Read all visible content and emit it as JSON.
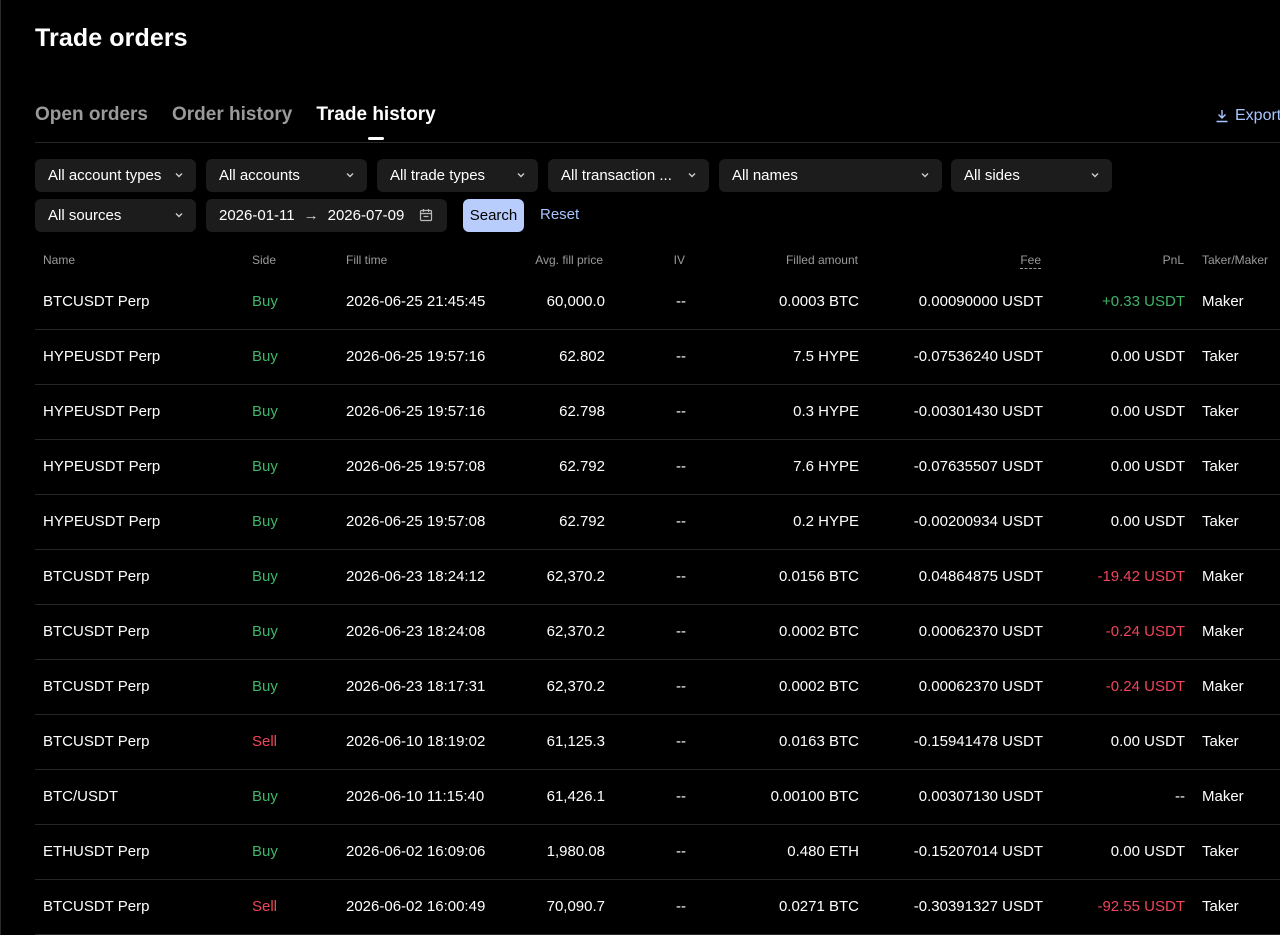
{
  "page": {
    "title": "Trade orders"
  },
  "tabs": [
    {
      "label": "Open orders",
      "active": false
    },
    {
      "label": "Order history",
      "active": false
    },
    {
      "label": "Trade history",
      "active": true
    }
  ],
  "export_label": "Export",
  "filters": {
    "account_types": "All account types",
    "accounts": "All accounts",
    "trade_types": "All trade types",
    "transaction": "All transaction ...",
    "names": "All names",
    "sides": "All sides",
    "sources": "All sources",
    "date_from": "2026-01-11",
    "date_arrow": "→",
    "date_to": "2026-07-09",
    "search_label": "Search",
    "reset_label": "Reset"
  },
  "colors": {
    "buy": "#3fb46a",
    "sell": "#f0455a",
    "accent": "#b9cdfc",
    "link": "#a9c4ff"
  },
  "table": {
    "headers": {
      "name": "Name",
      "side": "Side",
      "fill_time": "Fill time",
      "avg_fill_price": "Avg. fill price",
      "iv": "IV",
      "filled_amount": "Filled amount",
      "fee": "Fee",
      "pnl": "PnL",
      "taker_maker": "Taker/Maker"
    },
    "rows": [
      {
        "name": "BTCUSDT Perp",
        "side": "Buy",
        "time": "2026-06-25 21:45:45",
        "price": "60,000.0",
        "iv": "--",
        "amount": "0.0003 BTC",
        "fee": "0.00090000 USDT",
        "pnl": "+0.33 USDT",
        "pnl_sign": "pos",
        "role": "Maker"
      },
      {
        "name": "HYPEUSDT Perp",
        "side": "Buy",
        "time": "2026-06-25 19:57:16",
        "price": "62.802",
        "iv": "--",
        "amount": "7.5 HYPE",
        "fee": "-0.07536240 USDT",
        "pnl": "0.00 USDT",
        "pnl_sign": "zero",
        "role": "Taker"
      },
      {
        "name": "HYPEUSDT Perp",
        "side": "Buy",
        "time": "2026-06-25 19:57:16",
        "price": "62.798",
        "iv": "--",
        "amount": "0.3 HYPE",
        "fee": "-0.00301430 USDT",
        "pnl": "0.00 USDT",
        "pnl_sign": "zero",
        "role": "Taker"
      },
      {
        "name": "HYPEUSDT Perp",
        "side": "Buy",
        "time": "2026-06-25 19:57:08",
        "price": "62.792",
        "iv": "--",
        "amount": "7.6 HYPE",
        "fee": "-0.07635507 USDT",
        "pnl": "0.00 USDT",
        "pnl_sign": "zero",
        "role": "Taker"
      },
      {
        "name": "HYPEUSDT Perp",
        "side": "Buy",
        "time": "2026-06-25 19:57:08",
        "price": "62.792",
        "iv": "--",
        "amount": "0.2 HYPE",
        "fee": "-0.00200934 USDT",
        "pnl": "0.00 USDT",
        "pnl_sign": "zero",
        "role": "Taker"
      },
      {
        "name": "BTCUSDT Perp",
        "side": "Buy",
        "time": "2026-06-23 18:24:12",
        "price": "62,370.2",
        "iv": "--",
        "amount": "0.0156 BTC",
        "fee": "0.04864875 USDT",
        "pnl": "-19.42 USDT",
        "pnl_sign": "neg",
        "role": "Maker"
      },
      {
        "name": "BTCUSDT Perp",
        "side": "Buy",
        "time": "2026-06-23 18:24:08",
        "price": "62,370.2",
        "iv": "--",
        "amount": "0.0002 BTC",
        "fee": "0.00062370 USDT",
        "pnl": "-0.24 USDT",
        "pnl_sign": "neg",
        "role": "Maker"
      },
      {
        "name": "BTCUSDT Perp",
        "side": "Buy",
        "time": "2026-06-23 18:17:31",
        "price": "62,370.2",
        "iv": "--",
        "amount": "0.0002 BTC",
        "fee": "0.00062370 USDT",
        "pnl": "-0.24 USDT",
        "pnl_sign": "neg",
        "role": "Maker"
      },
      {
        "name": "BTCUSDT Perp",
        "side": "Sell",
        "time": "2026-06-10 18:19:02",
        "price": "61,125.3",
        "iv": "--",
        "amount": "0.0163 BTC",
        "fee": "-0.15941478 USDT",
        "pnl": "0.00 USDT",
        "pnl_sign": "zero",
        "role": "Taker"
      },
      {
        "name": "BTC/USDT",
        "side": "Buy",
        "time": "2026-06-10 11:15:40",
        "price": "61,426.1",
        "iv": "--",
        "amount": "0.00100 BTC",
        "fee": "0.00307130 USDT",
        "pnl": "--",
        "pnl_sign": "zero",
        "role": "Maker"
      },
      {
        "name": "ETHUSDT Perp",
        "side": "Buy",
        "time": "2026-06-02 16:09:06",
        "price": "1,980.08",
        "iv": "--",
        "amount": "0.480 ETH",
        "fee": "-0.15207014 USDT",
        "pnl": "0.00 USDT",
        "pnl_sign": "zero",
        "role": "Taker"
      },
      {
        "name": "BTCUSDT Perp",
        "side": "Sell",
        "time": "2026-06-02 16:00:49",
        "price": "70,090.7",
        "iv": "--",
        "amount": "0.0271 BTC",
        "fee": "-0.30391327 USDT",
        "pnl": "-92.55 USDT",
        "pnl_sign": "neg",
        "role": "Taker"
      }
    ]
  }
}
